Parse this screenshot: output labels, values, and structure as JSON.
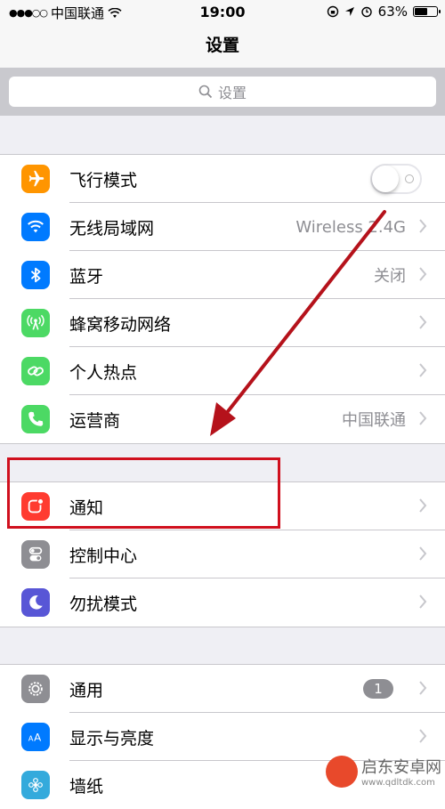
{
  "status": {
    "carrier": "中国联通",
    "time": "19:00",
    "battery": "63%",
    "battery_level": 0.63
  },
  "nav": {
    "title": "设置"
  },
  "search": {
    "placeholder": "设置"
  },
  "groups": [
    [
      {
        "label": "飞行模式",
        "icon": "airplane-icon",
        "color": "#ff9500",
        "toggle": false
      },
      {
        "label": "无线局域网",
        "icon": "wifi-icon",
        "color": "#007aff",
        "value": "Wireless 2.4G"
      },
      {
        "label": "蓝牙",
        "icon": "bluetooth-icon",
        "color": "#007aff",
        "value": "关闭"
      },
      {
        "label": "蜂窝移动网络",
        "icon": "cellular-icon",
        "color": "#4cd964"
      },
      {
        "label": "个人热点",
        "icon": "hotspot-icon",
        "color": "#4cd964"
      },
      {
        "label": "运营商",
        "icon": "phone-icon",
        "color": "#4cd964",
        "value": "中国联通"
      }
    ],
    [
      {
        "label": "通知",
        "icon": "notification-icon",
        "color": "#ff3b30"
      },
      {
        "label": "控制中心",
        "icon": "control-center-icon",
        "color": "#8e8e93"
      },
      {
        "label": "勿扰模式",
        "icon": "moon-icon",
        "color": "#5856d6"
      }
    ],
    [
      {
        "label": "通用",
        "icon": "gear-icon",
        "color": "#8e8e93",
        "badge": "1"
      },
      {
        "label": "显示与亮度",
        "icon": "display-icon",
        "color": "#007aff"
      },
      {
        "label": "墙纸",
        "icon": "wallpaper-icon",
        "color": "#34aadc"
      }
    ]
  ],
  "watermark": {
    "title": "启东安卓网",
    "sub": "www.qdltdk.com"
  }
}
